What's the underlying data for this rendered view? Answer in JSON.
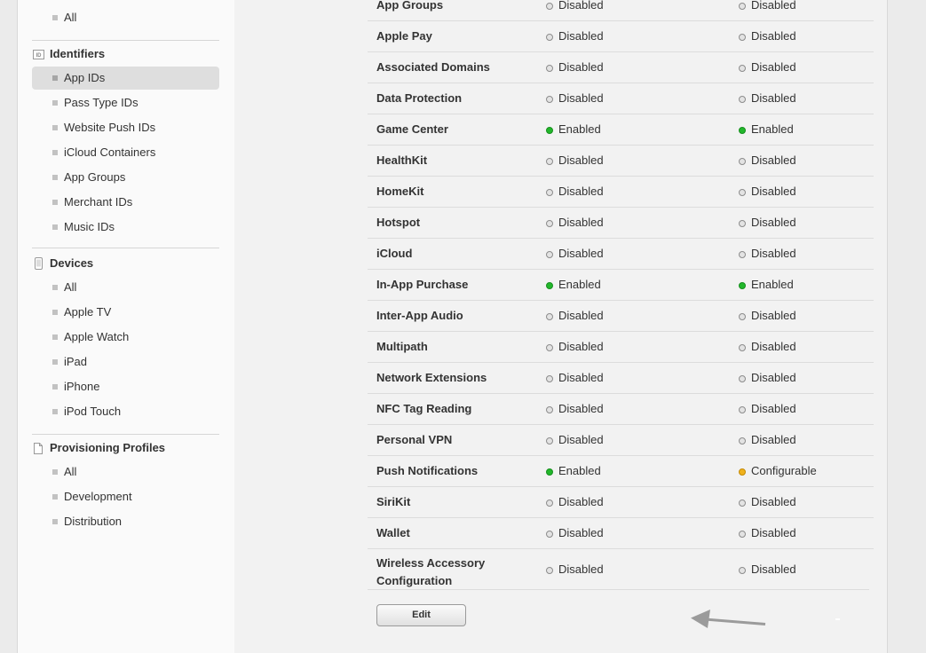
{
  "sidebar": {
    "top_items": [
      {
        "label": "All"
      }
    ],
    "identifiers": {
      "heading": "Identifiers",
      "icon": "id-badge-icon",
      "items": [
        {
          "label": "App IDs",
          "selected": true
        },
        {
          "label": "Pass Type IDs"
        },
        {
          "label": "Website Push IDs"
        },
        {
          "label": "iCloud Containers"
        },
        {
          "label": "App Groups"
        },
        {
          "label": "Merchant IDs"
        },
        {
          "label": "Music IDs"
        }
      ]
    },
    "devices": {
      "heading": "Devices",
      "icon": "phone-device-icon",
      "items": [
        {
          "label": "All"
        },
        {
          "label": "Apple TV"
        },
        {
          "label": "Apple Watch"
        },
        {
          "label": "iPad"
        },
        {
          "label": "iPhone"
        },
        {
          "label": "iPod Touch"
        }
      ]
    },
    "profiles": {
      "heading": "Provisioning Profiles",
      "icon": "document-icon",
      "items": [
        {
          "label": "All"
        },
        {
          "label": "Development"
        },
        {
          "label": "Distribution"
        }
      ]
    }
  },
  "capabilities": [
    {
      "name": "App Groups",
      "dev": "Disabled",
      "dist": "Disabled"
    },
    {
      "name": "Apple Pay",
      "dev": "Disabled",
      "dist": "Disabled"
    },
    {
      "name": "Associated Domains",
      "dev": "Disabled",
      "dist": "Disabled"
    },
    {
      "name": "Data Protection",
      "dev": "Disabled",
      "dist": "Disabled"
    },
    {
      "name": "Game Center",
      "dev": "Enabled",
      "dist": "Enabled"
    },
    {
      "name": "HealthKit",
      "dev": "Disabled",
      "dist": "Disabled"
    },
    {
      "name": "HomeKit",
      "dev": "Disabled",
      "dist": "Disabled"
    },
    {
      "name": "Hotspot",
      "dev": "Disabled",
      "dist": "Disabled"
    },
    {
      "name": "iCloud",
      "dev": "Disabled",
      "dist": "Disabled"
    },
    {
      "name": "In-App Purchase",
      "dev": "Enabled",
      "dist": "Enabled"
    },
    {
      "name": "Inter-App Audio",
      "dev": "Disabled",
      "dist": "Disabled"
    },
    {
      "name": "Multipath",
      "dev": "Disabled",
      "dist": "Disabled"
    },
    {
      "name": "Network Extensions",
      "dev": "Disabled",
      "dist": "Disabled"
    },
    {
      "name": "NFC Tag Reading",
      "dev": "Disabled",
      "dist": "Disabled"
    },
    {
      "name": "Personal VPN",
      "dev": "Disabled",
      "dist": "Disabled"
    },
    {
      "name": "Push Notifications",
      "dev": "Enabled",
      "dist": "Configurable"
    },
    {
      "name": "SiriKit",
      "dev": "Disabled",
      "dist": "Disabled"
    },
    {
      "name": "Wallet",
      "dev": "Disabled",
      "dist": "Disabled"
    },
    {
      "name": "Wireless Accessory Configuration",
      "dev": "Disabled",
      "dist": "Disabled"
    }
  ],
  "actions": {
    "edit_label": "Edit"
  },
  "colors": {
    "enabled": "#22b72b",
    "disabled": "#e3e3e3",
    "configurable": "#f0b21c",
    "arrow": "#9b9b9b"
  }
}
